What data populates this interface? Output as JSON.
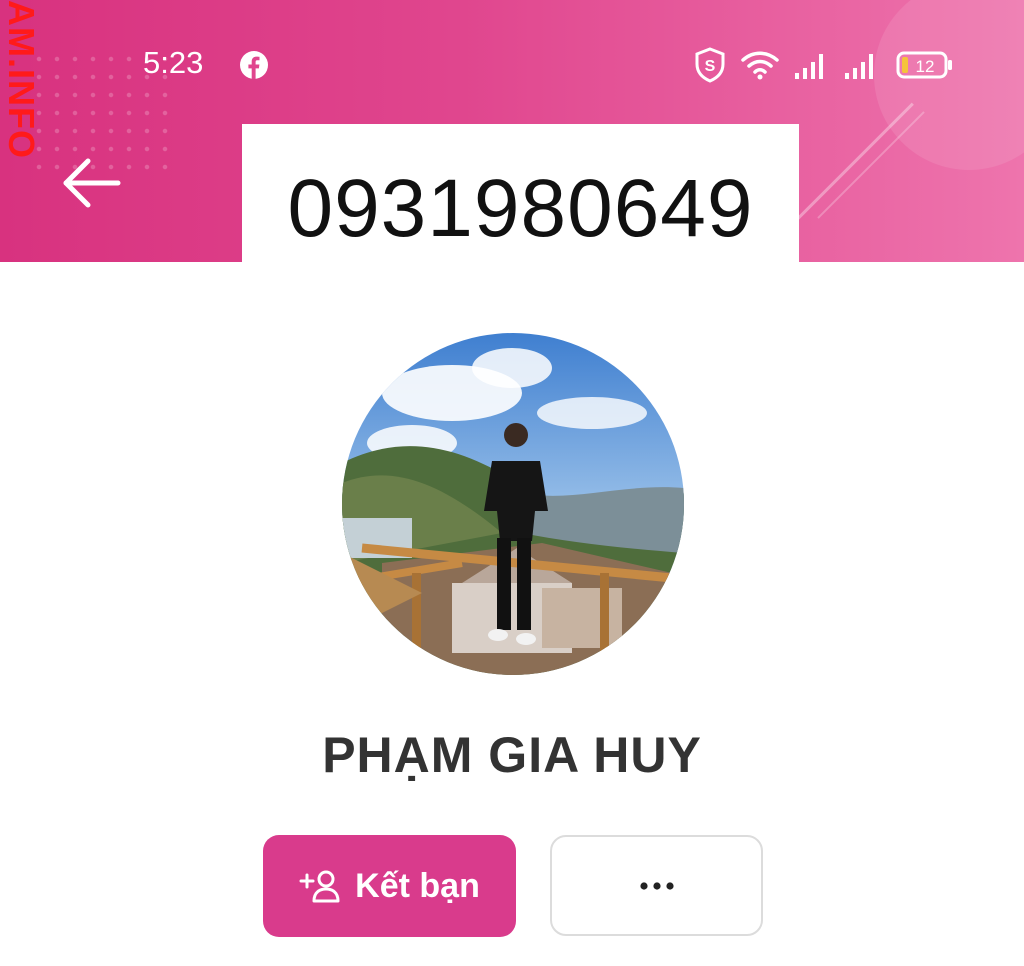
{
  "status_bar": {
    "time": "5:23",
    "battery_level": "12",
    "icons": [
      "facebook-icon",
      "shield-s-icon",
      "wifi-icon",
      "signal-1-icon",
      "signal-2-icon",
      "battery-icon"
    ]
  },
  "watermark": "AM.INFO",
  "header": {
    "phone_number": "0931980649",
    "back_icon": "back-arrow-icon"
  },
  "profile": {
    "name": "PHẠM GIA HUY"
  },
  "actions": {
    "add_friend_label": "Kết bạn",
    "add_friend_icon": "add-friend-icon",
    "more_icon": "more-dots-icon"
  },
  "colors": {
    "brand_pink": "#d93b8c",
    "header_pink": "#e0468e",
    "watermark_red": "#ff1a1a"
  }
}
